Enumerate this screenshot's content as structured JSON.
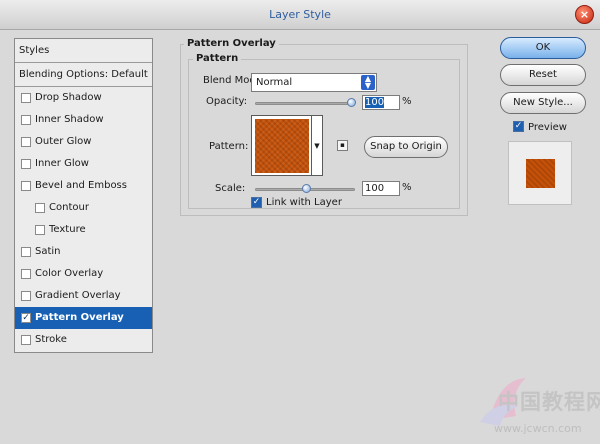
{
  "window": {
    "title": "Layer Style",
    "close_glyph": "×"
  },
  "styles_panel": {
    "header": "Styles",
    "blending": "Blending Options: Default",
    "items": [
      {
        "label": "Drop Shadow",
        "checked": false
      },
      {
        "label": "Inner Shadow",
        "checked": false
      },
      {
        "label": "Outer Glow",
        "checked": false
      },
      {
        "label": "Inner Glow",
        "checked": false
      },
      {
        "label": "Bevel and Emboss",
        "checked": false
      },
      {
        "label": "Contour",
        "checked": false
      },
      {
        "label": "Texture",
        "checked": false
      },
      {
        "label": "Satin",
        "checked": false
      },
      {
        "label": "Color Overlay",
        "checked": false
      },
      {
        "label": "Gradient Overlay",
        "checked": false
      },
      {
        "label": "Pattern Overlay",
        "checked": true
      },
      {
        "label": "Stroke",
        "checked": false
      }
    ],
    "check_glyph": "✓"
  },
  "pattern_overlay": {
    "section_title": "Pattern Overlay",
    "group_title": "Pattern",
    "blend_mode_label": "Blend Mode:",
    "blend_mode_value": "Normal",
    "opacity_label": "Opacity:",
    "opacity_value": "100",
    "opacity_percent": 100,
    "percent_sign": "%",
    "pattern_label": "Pattern:",
    "snap_label": "Snap to Origin",
    "scale_label": "Scale:",
    "scale_value": "100",
    "scale_slider_percent": 50,
    "link_label": "Link with Layer",
    "link_checked": true
  },
  "buttons": {
    "ok": "OK",
    "reset": "Reset",
    "new_style": "New Style..."
  },
  "preview": {
    "label": "Preview",
    "checked": true
  },
  "watermark": {
    "chinese": "中国教程网",
    "url": "www.jcwcn.com"
  },
  "colors": {
    "selection": "#1760b4",
    "pattern": "#c65108",
    "title_text": "#2f5e9e"
  }
}
